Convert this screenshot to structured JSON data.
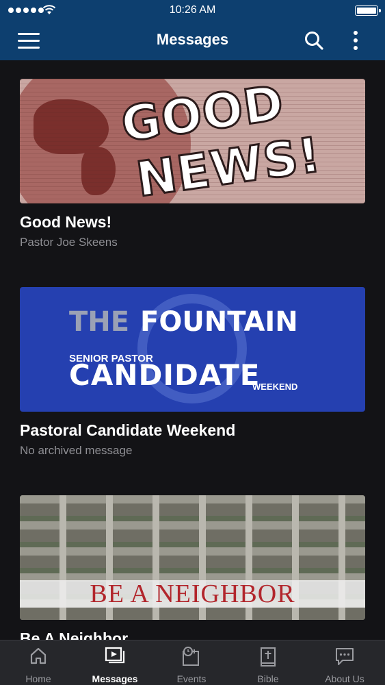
{
  "status_bar": {
    "time": "10:26 AM"
  },
  "header": {
    "title": "Messages"
  },
  "icons": {
    "menu": "hamburger-icon",
    "search": "search-icon",
    "more": "more-vertical-icon"
  },
  "messages": [
    {
      "title": "Good News!",
      "subtitle": "Pastor Joe Skeens",
      "thumb_text": [
        "GOOD",
        "NEWS!"
      ]
    },
    {
      "title": "Pastoral Candidate Weekend",
      "subtitle": "No archived message",
      "thumb_text": {
        "the": "THE",
        "fountain": "FOUNTAIN",
        "senior_pastor": "SENIOR PASTOR",
        "candidate": "CANDIDATE",
        "weekend": "WEEKEND"
      }
    },
    {
      "title": "Be A Neighbor",
      "subtitle": "",
      "thumb_text": "BE A NEIGHBOR"
    }
  ],
  "tabs": [
    {
      "label": "Home",
      "icon": "home-icon",
      "active": false
    },
    {
      "label": "Messages",
      "icon": "play-stack-icon",
      "active": true
    },
    {
      "label": "Events",
      "icon": "calendar-clock-icon",
      "active": false
    },
    {
      "label": "Bible",
      "icon": "bible-icon",
      "active": false
    },
    {
      "label": "About Us",
      "icon": "chat-icon",
      "active": false
    }
  ],
  "colors": {
    "header_bg": "#0d3f6f",
    "page_bg": "#131316",
    "tabbar_bg": "#26272b",
    "subtitle": "#8f8f94"
  }
}
